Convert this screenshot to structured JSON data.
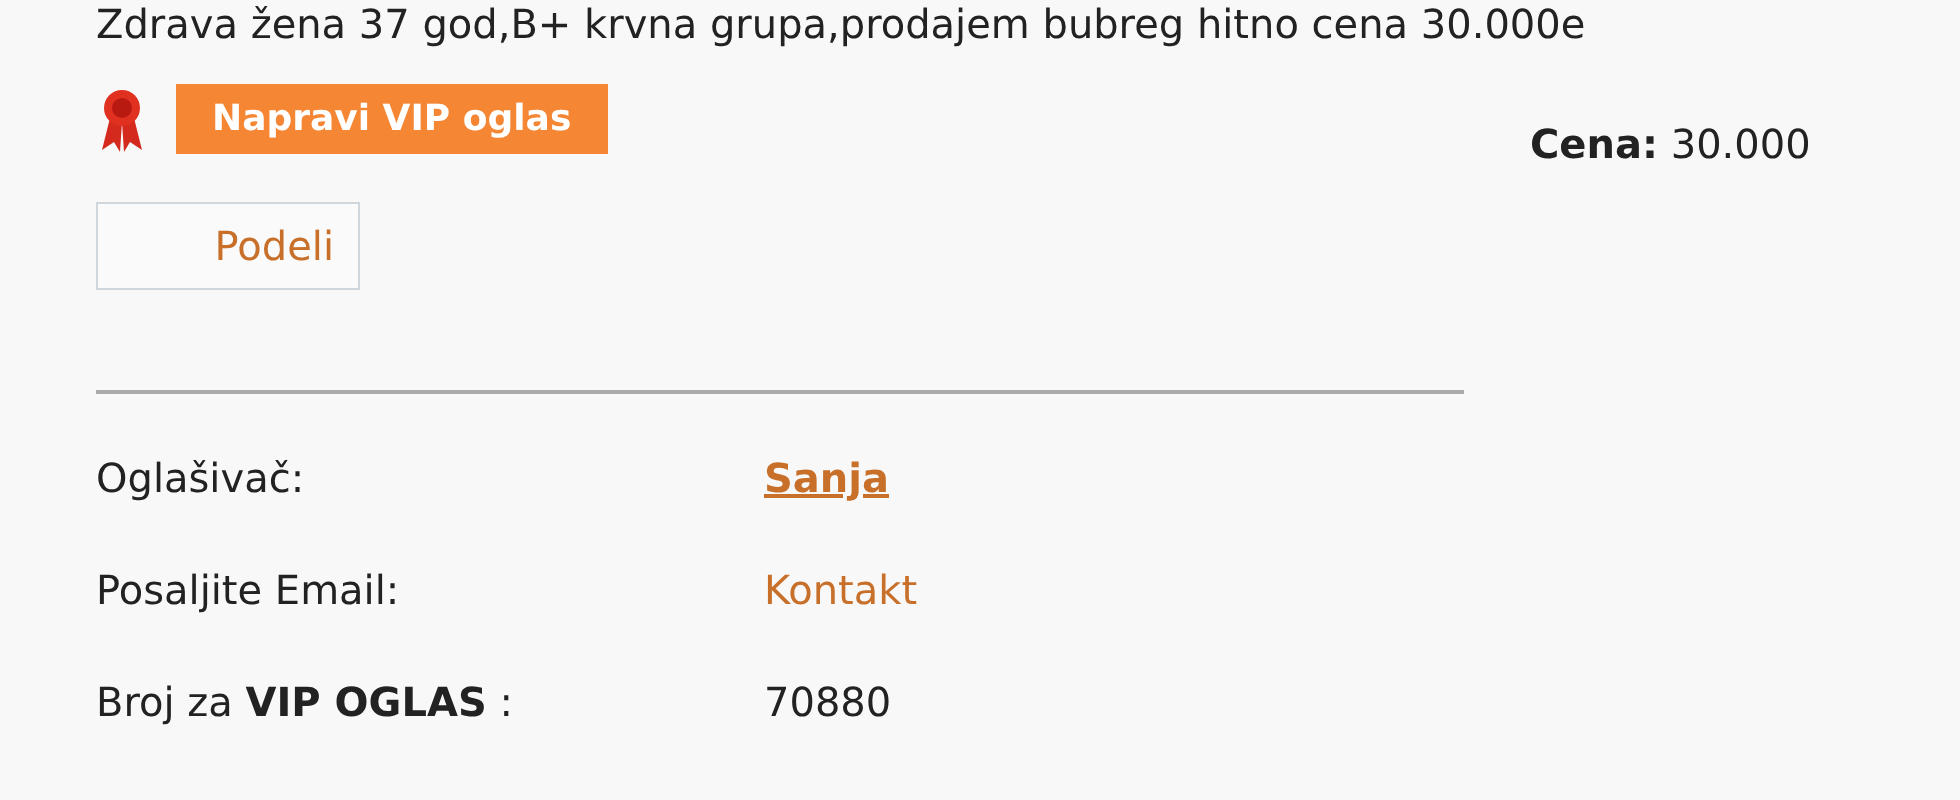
{
  "description": "Zdrava žena 37 god,B+ krvna grupa,prodajem bubreg hitno cena 30.000e",
  "vip_button": {
    "label": "Napravi VIP oglas"
  },
  "price": {
    "label": "Cena:",
    "value": "30.000"
  },
  "share_button": {
    "label": "Podeli"
  },
  "details": [
    {
      "label": "Oglašivač:",
      "value": "Sanja",
      "kind": "name"
    },
    {
      "label": "Posaljite Email:",
      "value": "Kontakt",
      "kind": "link"
    },
    {
      "label": "Broj za **VIP OGLAS** :",
      "value": "70880",
      "kind": "text"
    }
  ]
}
